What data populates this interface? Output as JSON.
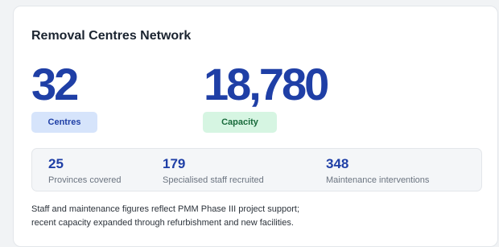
{
  "card": {
    "title": "Removal Centres Network"
  },
  "metrics": [
    {
      "value": "32",
      "label": "Centres",
      "badge_color": "#d6e4fb",
      "badge_text_color": "#1f3fa6"
    },
    {
      "value": "18,780",
      "label": "Capacity",
      "badge_color": "#d6f5e2",
      "badge_text_color": "#186a3b"
    }
  ],
  "stats": [
    {
      "value": "25",
      "label": "Provinces covered"
    },
    {
      "value": "179",
      "label": "Specialised staff recruited"
    },
    {
      "value": "348",
      "label": "Maintenance interventions"
    }
  ],
  "footnote": {
    "line1": "Staff and maintenance figures reflect PMM Phase III project support;",
    "line2": "recent capacity expanded through refurbishment and new facilities."
  },
  "colors": {
    "accent": "#1f3fa6",
    "background": "#f1f3f5",
    "card": "#ffffff"
  }
}
